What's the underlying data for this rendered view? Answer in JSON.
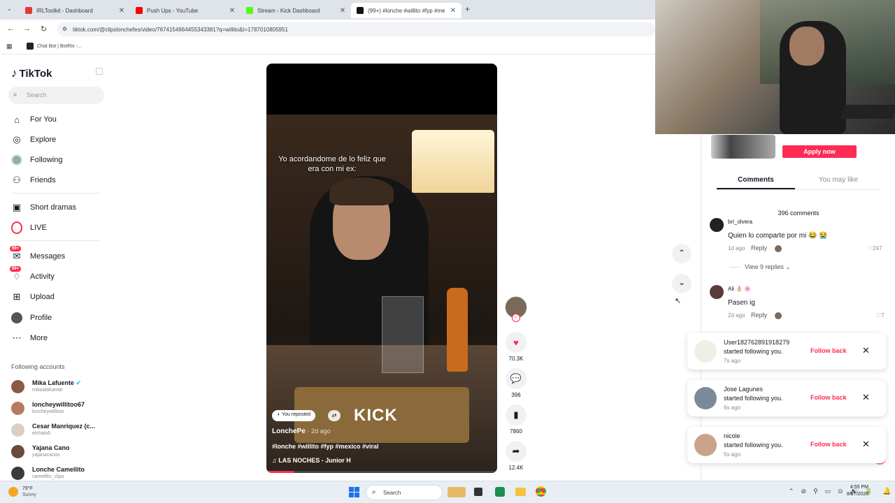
{
  "browser": {
    "tabs": [
      {
        "title": "IRLToolkit - Dashboard",
        "color": "#e53935"
      },
      {
        "title": "Push Ups - YouTube",
        "color": "#ff0000"
      },
      {
        "title": "Stream - Kick Dashboard",
        "color": "#53fc18"
      },
      {
        "title": "(99+) #lonche #willito #fyp #me",
        "color": "#111111"
      }
    ],
    "url": "tiktok.com/@clipslonchefes/video/7674154664455343381?q=willito&t=1787010805951",
    "bookmark": "Chat Bot | BotRix -..."
  },
  "sidebar": {
    "logo": "TikTok",
    "search_placeholder": "Search",
    "nav": [
      {
        "label": "For You",
        "icon": "home-icon"
      },
      {
        "label": "Explore",
        "icon": "compass-icon"
      },
      {
        "label": "Following",
        "icon": "following-icon"
      },
      {
        "label": "Friends",
        "icon": "friends-icon"
      },
      {
        "label": "Short dramas",
        "icon": "film-icon"
      },
      {
        "label": "LIVE",
        "icon": "live-icon"
      },
      {
        "label": "Messages",
        "icon": "messages-icon",
        "badge": "99+"
      },
      {
        "label": "Activity",
        "icon": "activity-icon",
        "badge": "99+"
      },
      {
        "label": "Upload",
        "icon": "upload-icon"
      },
      {
        "label": "Profile",
        "icon": "profile-icon"
      },
      {
        "label": "More",
        "icon": "more-icon"
      }
    ],
    "following_heading": "Following accounts",
    "accounts": [
      {
        "name": "Mika Lafuente",
        "handle": "mikaalafuente"
      },
      {
        "name": "loncheywillitoo67",
        "handle": "loncheywillitoo"
      },
      {
        "name": "Cesar Manriquez (c...",
        "handle": "elchalo6"
      },
      {
        "name": "Yajana Cano",
        "handle": "yajanacanoo"
      },
      {
        "name": "Lonche Camellito",
        "handle": "camellito_clips"
      }
    ]
  },
  "video": {
    "caption_overlay": "Yo acordandome de lo feliz que era con mi ex:",
    "reposted_badge": "You reposted",
    "watermark": "KICK",
    "author": "LonchePe",
    "posted": "· 2d ago",
    "hashtags": "#lonche #willito #fyp #mexico #viral",
    "music": "LAS NOCHES - Junior H"
  },
  "actions": {
    "likes": "70.3K",
    "comments": "396",
    "saves": "7860",
    "shares": "12.4K"
  },
  "panel": {
    "apply_button": "Apply now",
    "tabs": [
      "Comments",
      "You may like"
    ],
    "comment_count": "396 comments",
    "comments": [
      {
        "user": "bri_olvera",
        "text": "Quien lo comparte por mi 😂 😭",
        "age": "1d ago",
        "reply": "Reply",
        "likes": "247",
        "view_replies": "View 9 replies"
      },
      {
        "user": "Ali 👌🏼 🌸",
        "text": "Pasen ig",
        "age": "2d ago",
        "reply": "Reply",
        "likes": "7"
      }
    ]
  },
  "notifications": [
    {
      "user": "User182762891918279",
      "action": "started following you.",
      "age": "7s ago",
      "button": "Follow back"
    },
    {
      "user": "Jose Lagunes",
      "action": "started following you.",
      "age": "6s ago",
      "button": "Follow back"
    },
    {
      "user": "nicole",
      "action": "started following you.",
      "age": "5s ago",
      "button": "Follow back"
    }
  ],
  "taskbar": {
    "weather_temp": "79°F",
    "weather_desc": "Sunny",
    "search": "Search",
    "time": "4:55 PM",
    "date": "8/17/2026"
  },
  "colors": {
    "accent": "#fe2c55",
    "badge": "#fe2c55"
  }
}
